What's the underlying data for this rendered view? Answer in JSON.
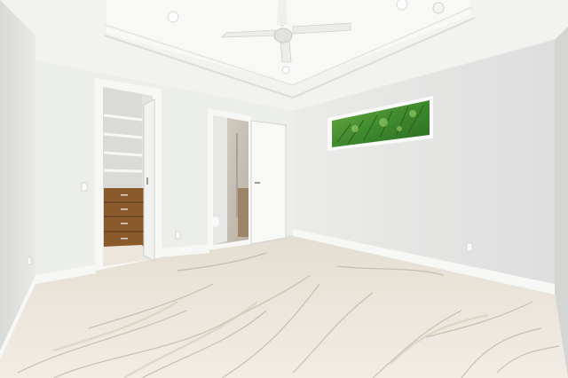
{
  "scene": {
    "subject": "empty-bedroom-interior",
    "colors": {
      "wall_left": "#e6e6e4",
      "wall_back": "#eeeeec",
      "wall_right": "#e8e8e6",
      "ceiling": "#f3f3f1",
      "tray_ceiling": "#f7f7f5",
      "floor_light": "#f1ece3",
      "floor_vein": "#b8ad9c",
      "trim": "#f6f6f4",
      "closet_interior": "#e3e3e0",
      "dresser_wood": "#8a5a2b",
      "window_foliage": "#3f8a2e",
      "bath_wall": "#cfc8bd"
    },
    "icons": [
      "ceiling-fan-icon",
      "recessed-light-icon",
      "outlet-icon",
      "light-switch-icon",
      "smoke-detector-icon"
    ]
  }
}
